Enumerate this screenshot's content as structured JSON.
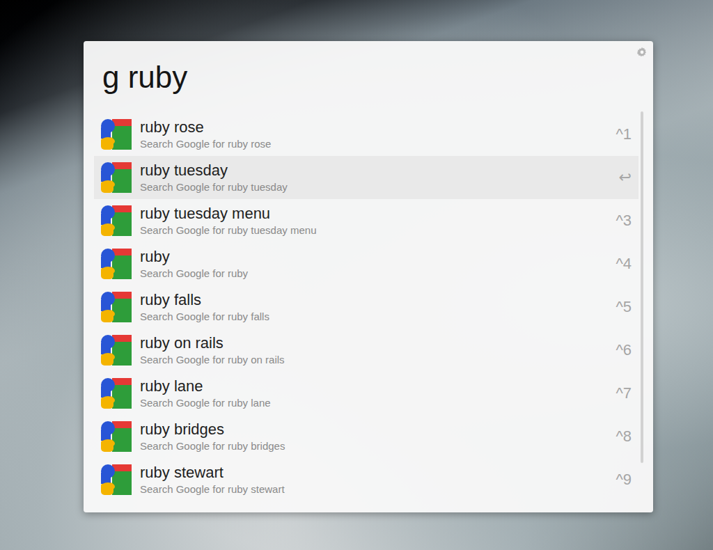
{
  "launcher": {
    "query": "g ruby",
    "results": [
      {
        "title": "ruby rose",
        "subtitle": "Search Google for ruby rose",
        "shortcut": "^1",
        "selected": false
      },
      {
        "title": "ruby tuesday",
        "subtitle": "Search Google for ruby tuesday",
        "shortcut": "↩",
        "selected": true
      },
      {
        "title": "ruby tuesday menu",
        "subtitle": "Search Google for ruby tuesday menu",
        "shortcut": "^3",
        "selected": false
      },
      {
        "title": "ruby",
        "subtitle": "Search Google for ruby",
        "shortcut": "^4",
        "selected": false
      },
      {
        "title": "ruby falls",
        "subtitle": "Search Google for ruby falls",
        "shortcut": "^5",
        "selected": false
      },
      {
        "title": "ruby on rails",
        "subtitle": "Search Google for ruby on rails",
        "shortcut": "^6",
        "selected": false
      },
      {
        "title": "ruby lane",
        "subtitle": "Search Google for ruby lane",
        "shortcut": "^7",
        "selected": false
      },
      {
        "title": "ruby bridges",
        "subtitle": "Search Google for ruby bridges",
        "shortcut": "^8",
        "selected": false
      },
      {
        "title": "ruby stewart",
        "subtitle": "Search Google for ruby stewart",
        "shortcut": "^9",
        "selected": false
      }
    ]
  }
}
